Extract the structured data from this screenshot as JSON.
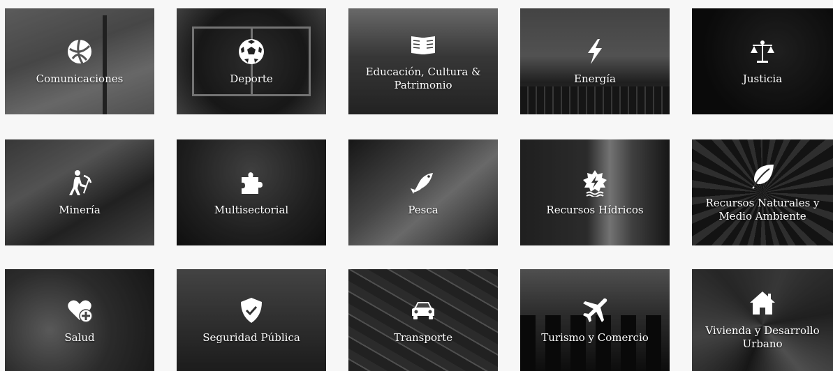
{
  "tiles": [
    {
      "label": "Comunicaciones",
      "icon": "globe-icon"
    },
    {
      "label": "Deporte",
      "icon": "soccer-ball-icon"
    },
    {
      "label": "Educación, Cultura & Patrimonio",
      "icon": "open-book-icon"
    },
    {
      "label": "Energía",
      "icon": "lightning-bolt-icon"
    },
    {
      "label": "Justicia",
      "icon": "scales-icon"
    },
    {
      "label": "Minería",
      "icon": "miner-icon"
    },
    {
      "label": "Multisectorial",
      "icon": "puzzle-icon"
    },
    {
      "label": "Pesca",
      "icon": "fish-icon"
    },
    {
      "label": "Recursos Hídricos",
      "icon": "water-badge-icon"
    },
    {
      "label": "Recursos Naturales y Medio Ambiente",
      "icon": "leaf-icon"
    },
    {
      "label": "Salud",
      "icon": "heart-plus-icon"
    },
    {
      "label": "Seguridad Pública",
      "icon": "shield-check-icon"
    },
    {
      "label": "Transporte",
      "icon": "car-icon"
    },
    {
      "label": "Turismo y Comercio",
      "icon": "airplane-icon"
    },
    {
      "label": "Vivienda y Desarrollo Urbano",
      "icon": "house-icon"
    }
  ],
  "colors": {
    "page_background": "#f7f7f7",
    "tile_text": "#ffffff"
  }
}
